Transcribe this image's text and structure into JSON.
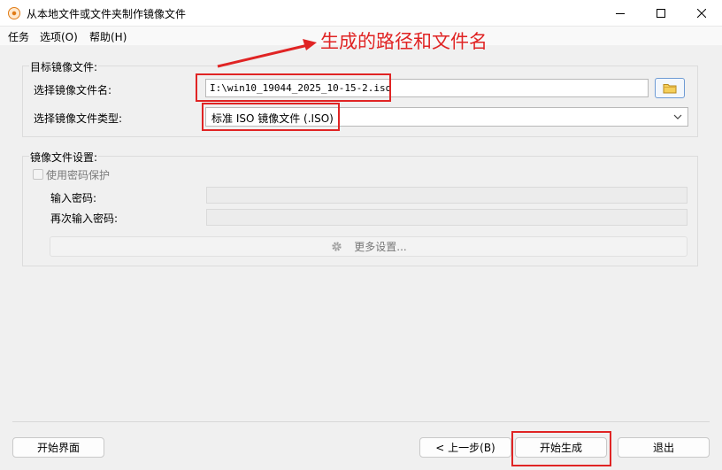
{
  "window": {
    "title": "从本地文件或文件夹制作镜像文件"
  },
  "menu": {
    "items": [
      "任务",
      "选项(O)",
      "帮助(H)"
    ]
  },
  "target_group": {
    "title": "目标镜像文件:",
    "filename_label": "选择镜像文件名:",
    "filename_value": "I:\\win10_19044_2025_10-15-2.iso",
    "type_label": "选择镜像文件类型:",
    "type_value": "标准 ISO 镜像文件 (.ISO)"
  },
  "settings_group": {
    "title": "镜像文件设置:",
    "password_protect_label": "使用密码保护",
    "password_label": "输入密码:",
    "password_confirm_label": "再次输入密码:",
    "more_settings_label": "更多设置..."
  },
  "buttons": {
    "start_page": "开始界面",
    "back": "< 上一步(B)",
    "generate": "开始生成",
    "exit": "退出"
  },
  "annotation": {
    "text": "生成的路径和文件名",
    "color": "#e02424"
  },
  "icons": {
    "app": "disc-icon",
    "browse": "folder-icon",
    "more_settings": "gear-icon"
  }
}
